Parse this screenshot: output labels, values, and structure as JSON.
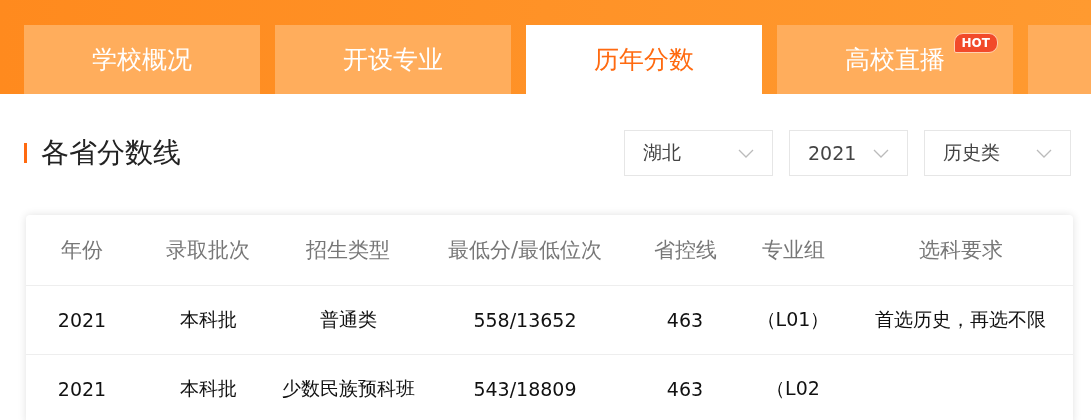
{
  "tabs": [
    {
      "label": "学校概况",
      "selected": false
    },
    {
      "label": "开设专业",
      "selected": false
    },
    {
      "label": "历年分数",
      "selected": true
    },
    {
      "label": "高校直播",
      "selected": false,
      "badge": "HOT"
    },
    {
      "selected": false
    }
  ],
  "section": {
    "title": "各省分数线",
    "filters": [
      {
        "value": "湖北"
      },
      {
        "value": "2021"
      },
      {
        "value": "历史类"
      }
    ]
  },
  "table": {
    "columns": [
      "年份",
      "录取批次",
      "招生类型",
      "最低分/最低位次",
      "省控线",
      "专业组",
      "选科要求"
    ],
    "rows": [
      [
        "2021",
        "本科批",
        "普通类",
        "558/13652",
        "463",
        "（L01）",
        "首选历史，再选不限"
      ],
      [
        "2021",
        "本科批",
        "少数民族预科班",
        "543/18809",
        "463",
        "（L02"
      ]
    ]
  }
}
